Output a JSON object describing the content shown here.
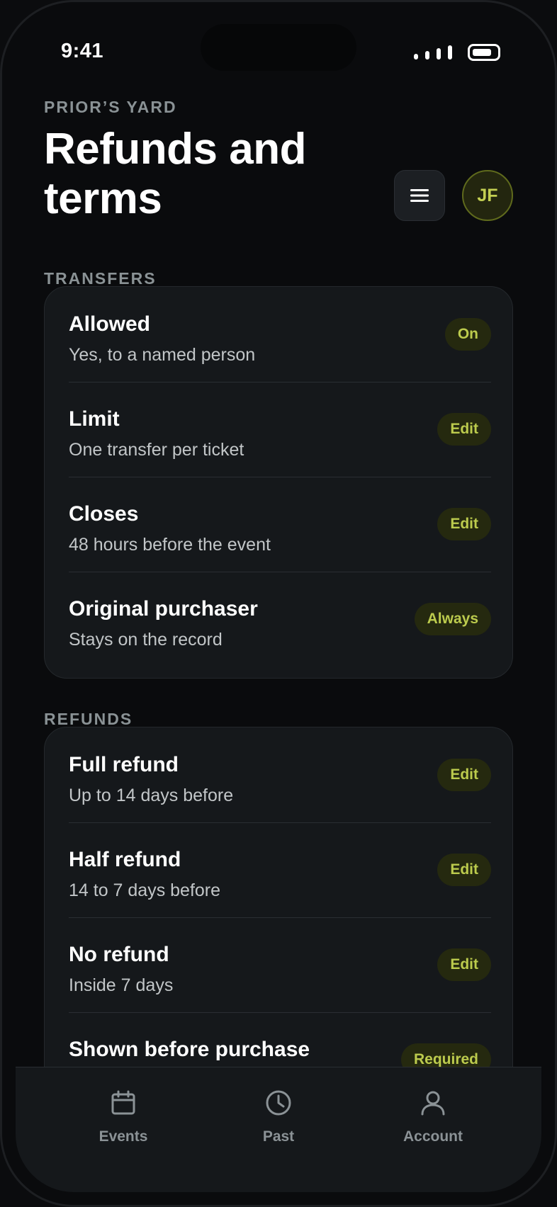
{
  "status": {
    "time": "9:41"
  },
  "header": {
    "eyebrow": "PRIOR’S YARD",
    "title": "Refunds and terms",
    "avatar_initials": "JF"
  },
  "sections": {
    "transfers": {
      "label": "TRANSFERS",
      "rows": [
        {
          "title": "Allowed",
          "subtitle": "Yes, to a named person",
          "action": "On"
        },
        {
          "title": "Limit",
          "subtitle": "One transfer per ticket",
          "action": "Edit"
        },
        {
          "title": "Closes",
          "subtitle": "48 hours before the event",
          "action": "Edit"
        },
        {
          "title": "Original purchaser",
          "subtitle": "Stays on the record",
          "action": "Always"
        }
      ]
    },
    "refunds": {
      "label": "REFUNDS",
      "rows": [
        {
          "title": "Full refund",
          "subtitle": "Up to 14 days before",
          "action": "Edit"
        },
        {
          "title": "Half refund",
          "subtitle": "14 to 7 days before",
          "action": "Edit"
        },
        {
          "title": "No refund",
          "subtitle": "Inside 7 days",
          "action": "Edit"
        },
        {
          "title": "Shown before purchase",
          "subtitle": "",
          "action": "Required"
        }
      ]
    }
  },
  "tabs": [
    {
      "label": "Events",
      "icon": "calendar-icon"
    },
    {
      "label": "Past",
      "icon": "clock-icon"
    },
    {
      "label": "Account",
      "icon": "person-icon"
    }
  ],
  "colors": {
    "background": "#0a0b0d",
    "card": "#15181b",
    "accent": "#bccb4d",
    "pill_background": "#25290f",
    "muted": "#8a9295"
  }
}
